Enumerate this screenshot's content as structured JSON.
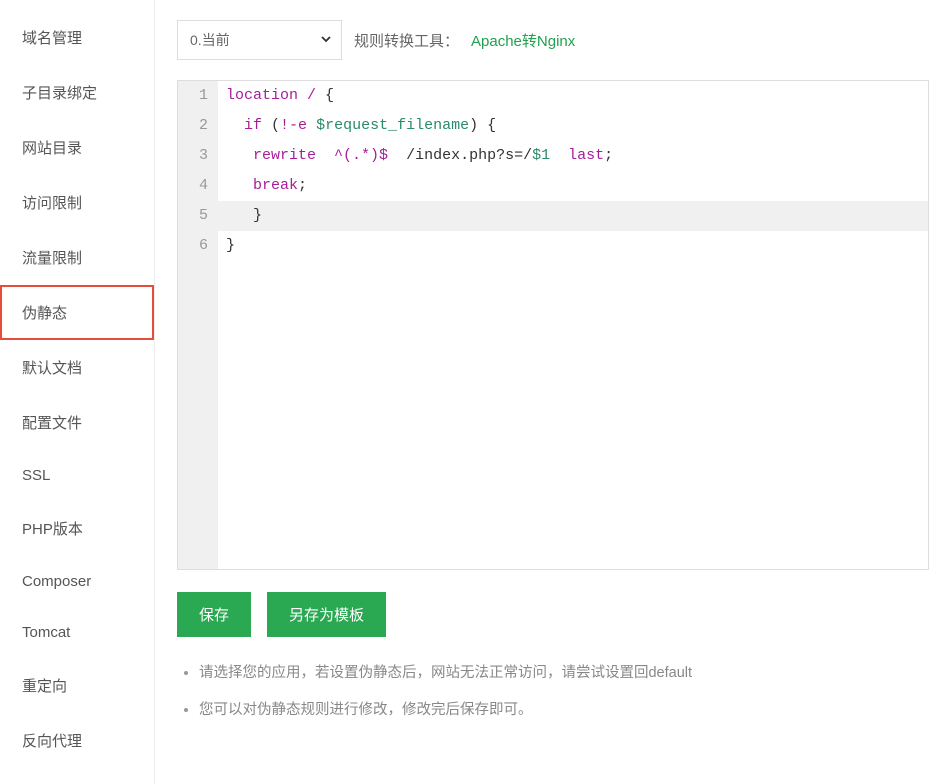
{
  "sidebar": {
    "items": [
      {
        "label": "域名管理"
      },
      {
        "label": "子目录绑定"
      },
      {
        "label": "网站目录"
      },
      {
        "label": "访问限制"
      },
      {
        "label": "流量限制"
      },
      {
        "label": "伪静态"
      },
      {
        "label": "默认文档"
      },
      {
        "label": "配置文件"
      },
      {
        "label": "SSL"
      },
      {
        "label": "PHP版本"
      },
      {
        "label": "Composer"
      },
      {
        "label": "Tomcat"
      },
      {
        "label": "重定向"
      },
      {
        "label": "反向代理"
      }
    ],
    "active_index": 5
  },
  "top": {
    "select_value": "0.当前",
    "conv_label": "规则转换工具：",
    "conv_link": "Apache转Nginx"
  },
  "code": {
    "active_line": 5,
    "lines": [
      {
        "n": "1",
        "segments": [
          {
            "t": "location",
            "c": "keyword"
          },
          {
            "t": " ",
            "c": "plain"
          },
          {
            "t": "/",
            "c": "op"
          },
          {
            "t": " {",
            "c": "punc"
          }
        ]
      },
      {
        "n": "2",
        "segments": [
          {
            "t": "  ",
            "c": "plain"
          },
          {
            "t": "if",
            "c": "keyword"
          },
          {
            "t": " (",
            "c": "punc"
          },
          {
            "t": "!-e",
            "c": "op"
          },
          {
            "t": " ",
            "c": "plain"
          },
          {
            "t": "$request_filename",
            "c": "var"
          },
          {
            "t": ") {",
            "c": "punc"
          }
        ]
      },
      {
        "n": "3",
        "segments": [
          {
            "t": "   ",
            "c": "plain"
          },
          {
            "t": "rewrite",
            "c": "keyword"
          },
          {
            "t": "  ",
            "c": "plain"
          },
          {
            "t": "^(.*)$",
            "c": "op"
          },
          {
            "t": "  /index.php?s=/",
            "c": "plain"
          },
          {
            "t": "$1",
            "c": "var"
          },
          {
            "t": "  ",
            "c": "plain"
          },
          {
            "t": "last",
            "c": "keyword"
          },
          {
            "t": ";",
            "c": "punc"
          }
        ]
      },
      {
        "n": "4",
        "segments": [
          {
            "t": "   ",
            "c": "plain"
          },
          {
            "t": "break",
            "c": "keyword"
          },
          {
            "t": ";",
            "c": "punc"
          }
        ]
      },
      {
        "n": "5",
        "segments": [
          {
            "t": "   }",
            "c": "punc"
          }
        ]
      },
      {
        "n": "6",
        "segments": [
          {
            "t": "}",
            "c": "punc"
          }
        ]
      }
    ]
  },
  "buttons": {
    "save": "保存",
    "save_as_template": "另存为模板"
  },
  "help": [
    "请选择您的应用，若设置伪静态后，网站无法正常访问，请尝试设置回default",
    "您可以对伪静态规则进行修改，修改完后保存即可。"
  ]
}
